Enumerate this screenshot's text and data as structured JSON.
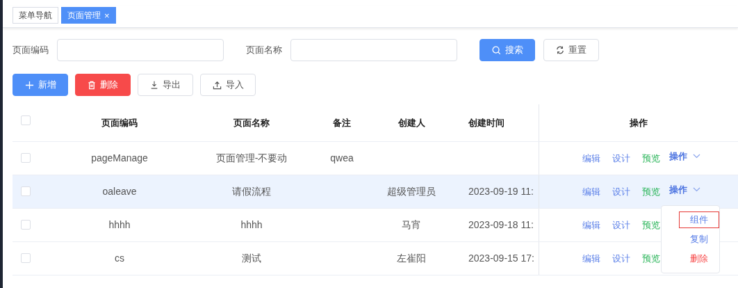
{
  "tabs": [
    {
      "label": "菜单导航",
      "selected": false
    },
    {
      "label": "页面管理",
      "selected": true,
      "close_glyph": "×"
    }
  ],
  "filters": [
    {
      "label": "页面编码"
    },
    {
      "label": "页面名称"
    }
  ],
  "filter_buttons": [
    {
      "label": "搜索",
      "kind": "primary"
    },
    {
      "label": "重置",
      "kind": "default"
    }
  ],
  "toolbar": [
    {
      "label": "新增",
      "kind": "primary"
    },
    {
      "label": "删除",
      "kind": "danger"
    },
    {
      "label": "导出",
      "kind": "default"
    },
    {
      "label": "导入",
      "kind": "default"
    }
  ],
  "table": {
    "select_all_checked": false,
    "columns": [
      "页面编码",
      "页面名称",
      "备注",
      "创建人",
      "创建时间",
      "操作"
    ],
    "rows": [
      {
        "checked": false,
        "selected": false,
        "cells": [
          "pageManage",
          "页面管理-不要动",
          "qwea",
          "",
          ""
        ],
        "actions": [
          {
            "label": "编辑",
            "kind": "link"
          },
          {
            "label": "设计",
            "kind": "link"
          },
          {
            "label": "预览",
            "kind": "success"
          }
        ],
        "more": "操作"
      },
      {
        "checked": false,
        "selected": true,
        "cells": [
          "oaleave",
          "请假流程",
          "",
          "超级管理员",
          "2023-09-19 11:"
        ],
        "actions": [
          {
            "label": "编辑",
            "kind": "link"
          },
          {
            "label": "设计",
            "kind": "link"
          },
          {
            "label": "预览",
            "kind": "success"
          }
        ],
        "more": "操作",
        "menu": [
          {
            "label": "组件",
            "kind": "link",
            "focused": true
          },
          {
            "label": "复制",
            "kind": "link",
            "focused": false
          },
          {
            "label": "删除",
            "kind": "danger",
            "focused": false
          }
        ]
      },
      {
        "checked": false,
        "selected": false,
        "cells": [
          "hhhh",
          "hhhh",
          "",
          "马宵",
          "2023-09-18 11:"
        ],
        "actions": [
          {
            "label": "编辑",
            "kind": "link"
          },
          {
            "label": "设计",
            "kind": "link"
          },
          {
            "label": "预览",
            "kind": "success"
          }
        ]
      },
      {
        "checked": false,
        "selected": false,
        "cells": [
          "cs",
          "测试",
          "",
          "左崔阳",
          "2023-09-15 17:"
        ],
        "actions": [
          {
            "label": "编辑",
            "kind": "link"
          },
          {
            "label": "设计",
            "kind": "link"
          },
          {
            "label": "预览",
            "kind": "success"
          }
        ]
      }
    ]
  }
}
